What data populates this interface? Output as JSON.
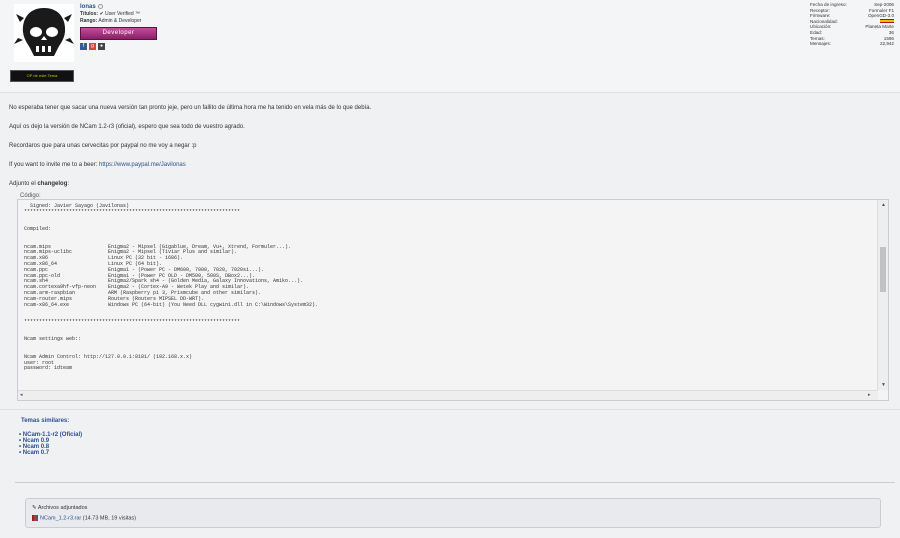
{
  "user": {
    "username": "lonas",
    "titles_label": "Títulos:",
    "titles_value": "✔ User Verified ™",
    "rank_label": "Rango:",
    "rank_value": "Admin & Developer",
    "badge": "Developer",
    "topic_badge": "OP de este Tema"
  },
  "stats": [
    {
      "label": "Fecha de ingreso:",
      "value": "Sep-2006"
    },
    {
      "label": "Receptor:",
      "value": "Formuler F1"
    },
    {
      "label": "Firmware:",
      "value": "OpenGD-3.0"
    },
    {
      "label": "Nacionalidad:",
      "value": ""
    },
    {
      "label": "Ubicación:",
      "value": "Planeta Marte"
    },
    {
      "label": "Edad:",
      "value": "36"
    },
    {
      "label": "Temas:",
      "value": "1596"
    },
    {
      "label": "Mensajes:",
      "value": "22,942"
    }
  ],
  "body": {
    "p1": "No esperaba tener que sacar una nueva versión tan pronto jeje, pero un fallito de última hora me ha tenido en vela más de lo que debía.",
    "p2": "Aquí os dejo la versión de NCam 1.2-r3 (oficial), espero que sea todo de vuestro agrado.",
    "p3": "Recordaros que para unas cervecitas por paypal no me voy a negar :p",
    "p4_prefix": "If you want to invite me to a beer: ",
    "p4_link": "https://www.paypal.me/Javilonas",
    "p5_prefix": "Adjunto el ",
    "p5_bold": "changelog",
    "p5_suffix": ":"
  },
  "code": {
    "label": "Código:",
    "text": "  Signed: Javier Sayago (Javilonas)\n************************************************************************\n\n\nCompiled:\n\n\nncam.mips                   Enigma2 - Mipsel (Gigablue, Dream, Vu+, Xtrend, Formuler...).\nncam.mips-uclibc            Enigma2 - Mipsel (Tiviar Plus and similar).\nncam.x86                    Linux PC (32 bit - i686).\nncam.x86_64                 Linux PC (64 bit).\nncam.ppc                    Enigma1 - (Power PC - DM600, 7000, 7020, 7020si...).\nncam.ppc-old                Enigma1 - (Power PC OLD - DM500, 500S, DBox2...).\nncam.sh4                    Enigma2/Spark sh4 - (Golden Media, Galaxy Innovations, Amiko...).\nncam.cortexa9hf-vfp-neon    Enigma2 - (Cortex-A9 - Wetek Play and similar).\nncam.arm-raspbian           ARM (Raspberry pi 3, Prismcube and other similars).\nncam-router.mips            Routers (Routers MIPSEL DD-WRT).\nncam-x86_64.exe             Windows PC (64-bit) (You Need DLL cygwin1.dll in C:\\Windows\\System32).\n\n\n************************************************************************\n\n\nNcam settings web::\n\n\nNcam Admin Control: http://127.0.0.1:8181/ (192.168.x.x)\nuser: root\npassword: 1dteam"
  },
  "similar": {
    "title": "Temas similares:",
    "items": [
      "NCam-1.1-r2 (Oficial)",
      "Ncam 0.9",
      "Ncam 0.8",
      "Ncam 0.7"
    ]
  },
  "attachments": {
    "title": "Archivos adjuntados",
    "file_name": "NCam_1.2-r3.rar",
    "file_meta": " (14.73 MB, 19 visitas)"
  }
}
